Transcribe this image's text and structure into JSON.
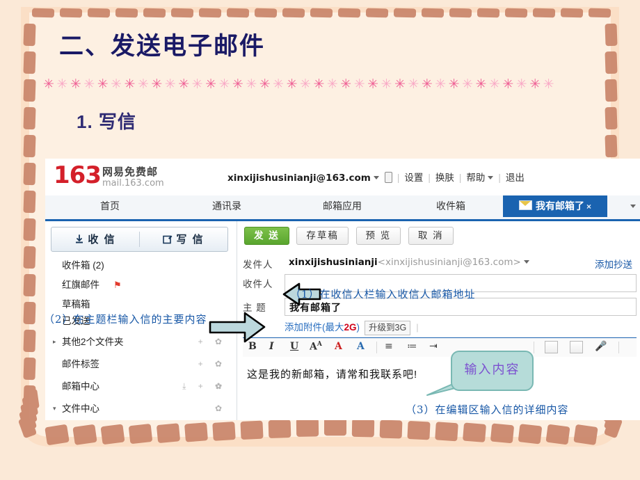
{
  "slide": {
    "title": "二、发送电子邮件",
    "subtitle": "1. 写信",
    "divider_char": "✳",
    "divider_count": 38,
    "colors": {
      "title": "#1a1a66",
      "subtitle": "#2e2a73",
      "divider_dark": "#ef5f95",
      "divider_light": "#f9a9c6",
      "frame": "#c98469",
      "background": "#fdf0e2"
    }
  },
  "mail_client": {
    "logo": {
      "number": "163",
      "name": "网易免费邮",
      "url": "mail.163.com"
    },
    "account_bar": {
      "email": "xinxijishusinianji@163.com",
      "links": [
        "设置",
        "换肤",
        "帮助",
        "退出"
      ]
    },
    "tabs": [
      {
        "label": "首页",
        "active": false
      },
      {
        "label": "通讯录",
        "active": false
      },
      {
        "label": "邮箱应用",
        "active": false
      },
      {
        "label": "收件箱",
        "active": false
      },
      {
        "label": "我有邮箱了",
        "active": true,
        "close": "×"
      }
    ],
    "sidebar": {
      "receive_button": "收 信",
      "compose_button": "写 信",
      "folders": [
        {
          "name": "收件箱 (2)",
          "icons": ""
        },
        {
          "name": "红旗邮件",
          "flag": true,
          "icons": ""
        },
        {
          "name": "草稿箱",
          "icons": ""
        },
        {
          "name": "已发送",
          "icons": ""
        },
        {
          "name": "其他2个文件夹",
          "icons": "+ ✿",
          "expander": "▸"
        },
        {
          "name": "邮件标签",
          "icons": "+ ✿"
        },
        {
          "name": "邮箱中心",
          "icons": "⤓ + ✿"
        },
        {
          "name": "文件中心",
          "icons": "✿",
          "expander": "▾"
        }
      ]
    },
    "compose": {
      "actions": [
        "发 送",
        "存草稿",
        "预 览",
        "取 消"
      ],
      "from_label": "发件人",
      "from_name": "xinxijishusinianji",
      "from_address": "<xinxijishusinianji@163.com>",
      "cc_link": "添加抄送",
      "to_label": "收件人",
      "to_value": "",
      "subject_label": "主  题",
      "subject_value": "我有邮箱了",
      "attach_link_prefix": "添加附件(最大",
      "attach_link_size": "2G",
      "attach_link_suffix": ")",
      "upgrade_button": "升级到3G",
      "body_text": "这是我的新邮箱，请常和我联系吧!"
    },
    "editor_toolbar": {
      "bold": "B",
      "italic": "I",
      "underline": "U",
      "font_size": "A",
      "text_color": "A",
      "bg_color": "A",
      "align": "≡",
      "list": "≔",
      "indent": "⇥"
    }
  },
  "annotations": {
    "step1": "（1）在收信人栏输入收信人邮箱地址",
    "step2": "（2）在主题栏输入信的主要内容",
    "step3": "（3）在编辑区输入信的详细内容",
    "bubble": "输入内容"
  }
}
